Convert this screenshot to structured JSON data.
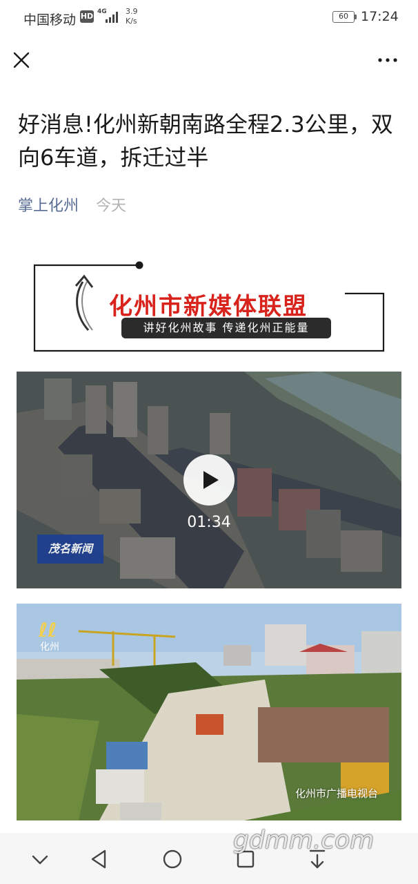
{
  "status_bar": {
    "carrier": "中国移动",
    "hd": "HD",
    "network": "4G",
    "speed_value": "3.9",
    "speed_unit": "K/s",
    "battery": "60",
    "time": "17:24"
  },
  "top_bar": {
    "close_icon": "close-icon",
    "more_icon": "more-dots-icon"
  },
  "article": {
    "title": "好消息!化州新朝南路全程2.3公里，双向6车道，拆迁过半",
    "author": "掌上化州",
    "date": "今天"
  },
  "banner": {
    "title": "化州市新媒体联盟",
    "slogan": "讲好化州故事 传递化州正能量"
  },
  "video": {
    "duration": "01:34",
    "channel_logo": "茂名新闻",
    "play_icon": "play-icon"
  },
  "photo": {
    "logo": "ℓℓ",
    "logo_sub": "化州",
    "caption": "化州市广播电视台"
  },
  "nav_bar": {
    "icons": [
      "chevron-down-icon",
      "back-icon",
      "home-icon",
      "recent-apps-icon",
      "download-icon"
    ]
  },
  "watermark": "gdmm.com",
  "colors": {
    "link": "#576b95",
    "banner_red": "#d8231c",
    "muted": "#b2b2b2"
  }
}
